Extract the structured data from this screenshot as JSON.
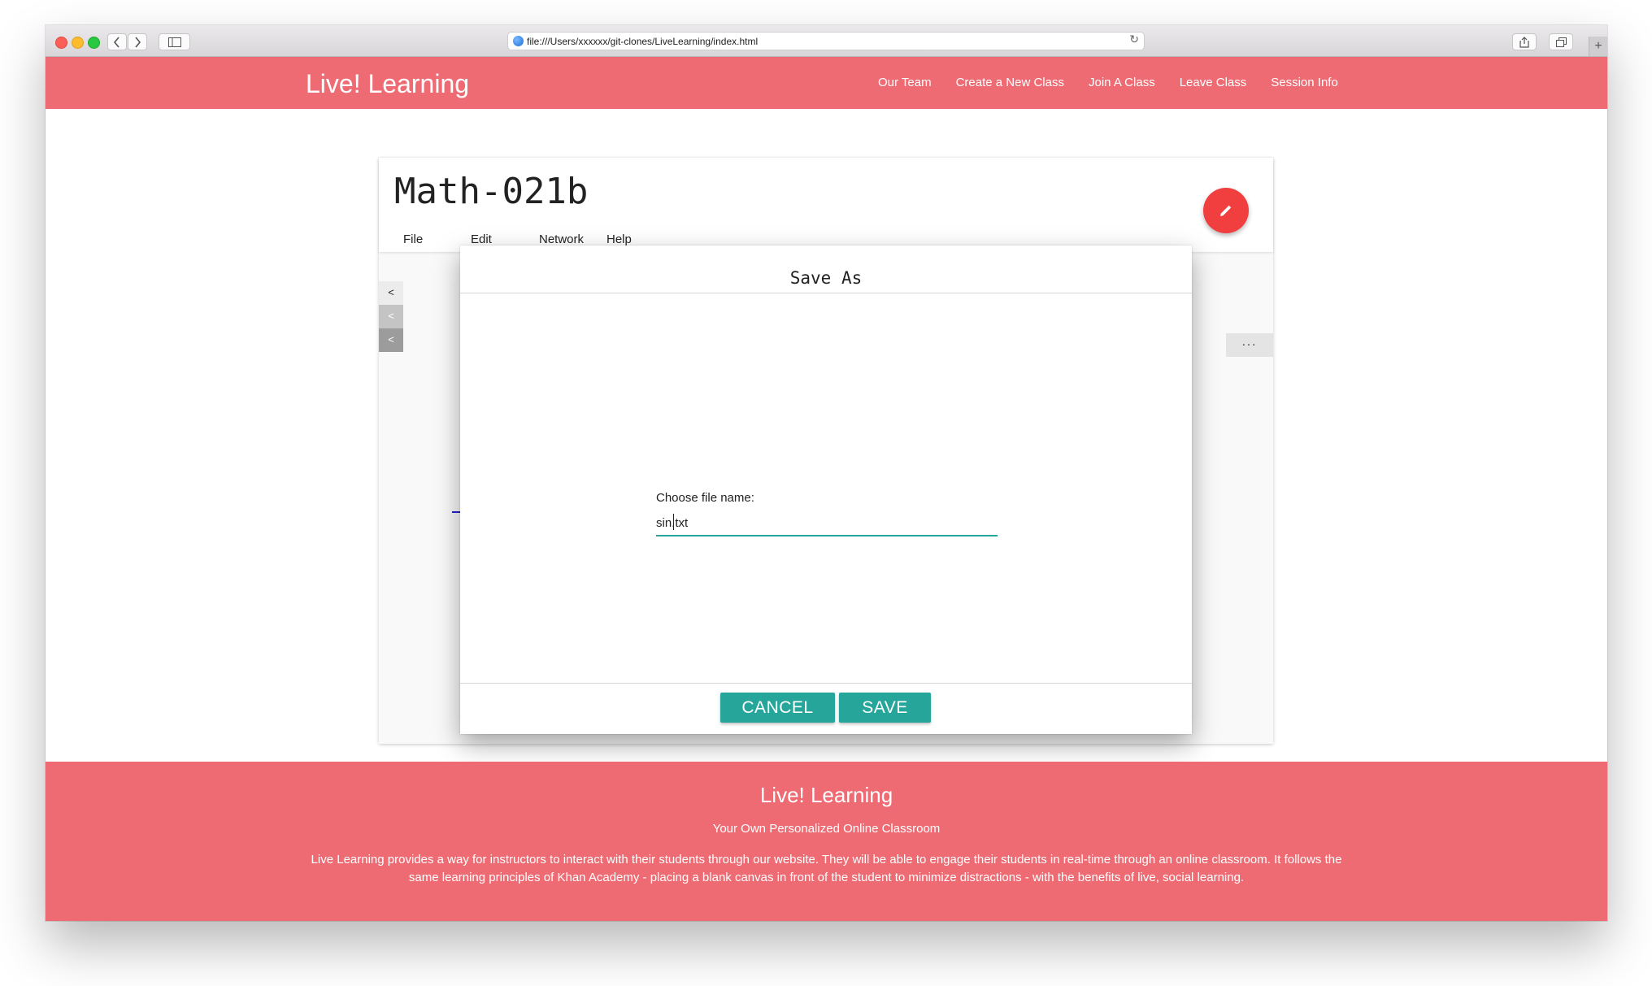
{
  "browser": {
    "url": "file:///Users/xxxxxx/git-clones/LiveLearning/index.html"
  },
  "header": {
    "brand": "Live! Learning",
    "nav": [
      {
        "label": "Our Team"
      },
      {
        "label": "Create a New Class"
      },
      {
        "label": "Join A Class"
      },
      {
        "label": "Leave Class"
      },
      {
        "label": "Session Info"
      }
    ]
  },
  "classroom": {
    "title": "Math-021b",
    "menu": [
      {
        "label": "File"
      },
      {
        "label": "Edit"
      },
      {
        "label": "Network"
      },
      {
        "label": "Help"
      }
    ],
    "side_tabs": [
      {
        "label": "<"
      },
      {
        "label": "<"
      },
      {
        "label": "<"
      }
    ],
    "more_label": "..."
  },
  "dialog": {
    "title": "Save As",
    "label": "Choose file name:",
    "filename": "sin.txt",
    "cancel_label": "CANCEL",
    "save_label": "SAVE"
  },
  "footer": {
    "title": "Live! Learning",
    "subtitle": "Your Own Personalized Online Classroom",
    "description": "Live Learning provides a way for instructors to interact with their students through our website. They will be able to engage their students in real-time through an online classroom. It follows the same learning principles of Khan Academy - placing a blank canvas in front of the student to minimize distractions - with the benefits of live, social learning."
  },
  "colors": {
    "brand": "#ef6b73",
    "accent": "#26a69a",
    "fab": "#f13f40"
  },
  "icons": {
    "fab": "pencil-icon",
    "back": "chevron-left-icon",
    "forward": "chevron-right-icon",
    "sidebar": "sidebar-icon",
    "share": "share-icon",
    "tabs": "tabs-icon",
    "reload": "reload-icon"
  }
}
